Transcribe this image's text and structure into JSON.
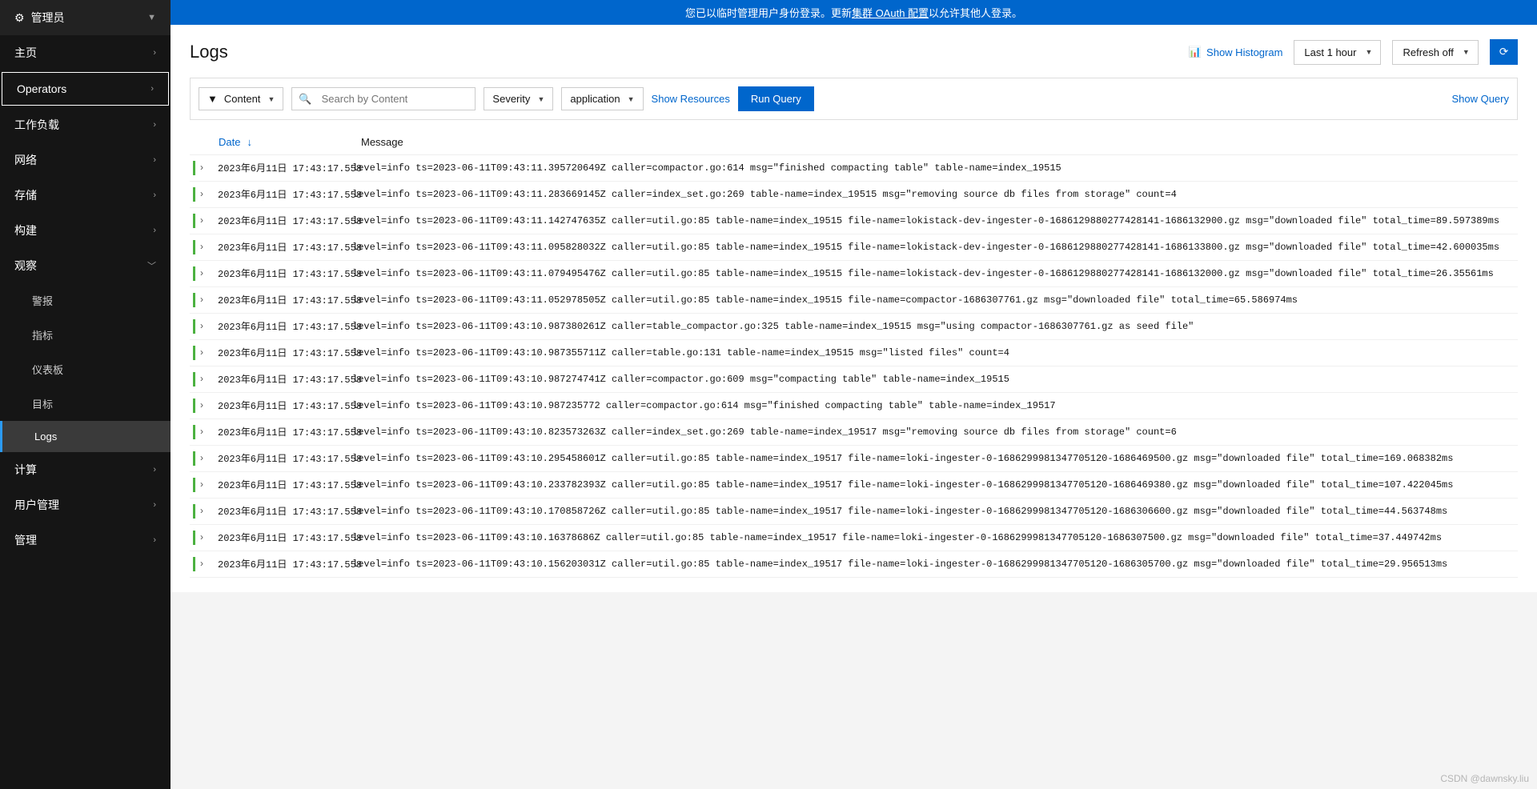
{
  "banner": {
    "prefix": "您已以临时管理用户身份登录。更新",
    "link": "集群 OAuth 配置",
    "suffix": "以允许其他人登录。"
  },
  "sidebar": {
    "admin": "管理员",
    "items": [
      {
        "label": "主页"
      },
      {
        "label": "Operators",
        "selected": true
      },
      {
        "label": "工作负载"
      },
      {
        "label": "网络"
      },
      {
        "label": "存储"
      },
      {
        "label": "构建"
      },
      {
        "label": "观察",
        "expanded": true,
        "children": [
          {
            "label": "警报"
          },
          {
            "label": "指标"
          },
          {
            "label": "仪表板"
          },
          {
            "label": "目标"
          },
          {
            "label": "Logs",
            "active": true
          }
        ]
      },
      {
        "label": "计算"
      },
      {
        "label": "用户管理"
      },
      {
        "label": "管理"
      }
    ]
  },
  "page": {
    "title": "Logs",
    "show_histogram": "Show Histogram",
    "time_range": "Last 1 hour",
    "refresh": "Refresh off"
  },
  "query_bar": {
    "content": "Content",
    "search_placeholder": "Search by Content",
    "severity": "Severity",
    "log_type": "application",
    "show_resources": "Show Resources",
    "run_query": "Run Query",
    "show_query": "Show Query"
  },
  "table": {
    "date_header": "Date",
    "message_header": "Message"
  },
  "logs": [
    {
      "date": "2023年6月11日 17:43:17.558",
      "msg": "level=info ts=2023-06-11T09:43:11.395720649Z caller=compactor.go:614 msg=\"finished compacting table\" table-name=index_19515"
    },
    {
      "date": "2023年6月11日 17:43:17.558",
      "msg": "level=info ts=2023-06-11T09:43:11.283669145Z caller=index_set.go:269 table-name=index_19515 msg=\"removing source db files from storage\" count=4"
    },
    {
      "date": "2023年6月11日 17:43:17.558",
      "msg": "level=info ts=2023-06-11T09:43:11.142747635Z caller=util.go:85 table-name=index_19515 file-name=lokistack-dev-ingester-0-1686129880277428141-1686132900.gz msg=\"downloaded file\" total_time=89.597389ms"
    },
    {
      "date": "2023年6月11日 17:43:17.558",
      "msg": "level=info ts=2023-06-11T09:43:11.095828032Z caller=util.go:85 table-name=index_19515 file-name=lokistack-dev-ingester-0-1686129880277428141-1686133800.gz msg=\"downloaded file\" total_time=42.600035ms"
    },
    {
      "date": "2023年6月11日 17:43:17.558",
      "msg": "level=info ts=2023-06-11T09:43:11.079495476Z caller=util.go:85 table-name=index_19515 file-name=lokistack-dev-ingester-0-1686129880277428141-1686132000.gz msg=\"downloaded file\" total_time=26.35561ms"
    },
    {
      "date": "2023年6月11日 17:43:17.558",
      "msg": "level=info ts=2023-06-11T09:43:11.052978505Z caller=util.go:85 table-name=index_19515 file-name=compactor-1686307761.gz msg=\"downloaded file\" total_time=65.586974ms"
    },
    {
      "date": "2023年6月11日 17:43:17.558",
      "msg": "level=info ts=2023-06-11T09:43:10.987380261Z caller=table_compactor.go:325 table-name=index_19515 msg=\"using compactor-1686307761.gz as seed file\""
    },
    {
      "date": "2023年6月11日 17:43:17.558",
      "msg": "level=info ts=2023-06-11T09:43:10.987355711Z caller=table.go:131 table-name=index_19515 msg=\"listed files\" count=4"
    },
    {
      "date": "2023年6月11日 17:43:17.558",
      "msg": "level=info ts=2023-06-11T09:43:10.987274741Z caller=compactor.go:609 msg=\"compacting table\" table-name=index_19515"
    },
    {
      "date": "2023年6月11日 17:43:17.558",
      "msg": "level=info ts=2023-06-11T09:43:10.987235772 caller=compactor.go:614 msg=\"finished compacting table\" table-name=index_19517"
    },
    {
      "date": "2023年6月11日 17:43:17.558",
      "msg": "level=info ts=2023-06-11T09:43:10.823573263Z caller=index_set.go:269 table-name=index_19517 msg=\"removing source db files from storage\" count=6"
    },
    {
      "date": "2023年6月11日 17:43:17.558",
      "msg": "level=info ts=2023-06-11T09:43:10.295458601Z caller=util.go:85 table-name=index_19517 file-name=loki-ingester-0-1686299981347705120-1686469500.gz msg=\"downloaded file\" total_time=169.068382ms"
    },
    {
      "date": "2023年6月11日 17:43:17.558",
      "msg": "level=info ts=2023-06-11T09:43:10.233782393Z caller=util.go:85 table-name=index_19517 file-name=loki-ingester-0-1686299981347705120-1686469380.gz msg=\"downloaded file\" total_time=107.422045ms"
    },
    {
      "date": "2023年6月11日 17:43:17.558",
      "msg": "level=info ts=2023-06-11T09:43:10.170858726Z caller=util.go:85 table-name=index_19517 file-name=loki-ingester-0-1686299981347705120-1686306600.gz msg=\"downloaded file\" total_time=44.563748ms"
    },
    {
      "date": "2023年6月11日 17:43:17.558",
      "msg": "level=info ts=2023-06-11T09:43:10.16378686Z caller=util.go:85 table-name=index_19517 file-name=loki-ingester-0-1686299981347705120-1686307500.gz msg=\"downloaded file\" total_time=37.449742ms"
    },
    {
      "date": "2023年6月11日 17:43:17.558",
      "msg": "level=info ts=2023-06-11T09:43:10.156203031Z caller=util.go:85 table-name=index_19517 file-name=loki-ingester-0-1686299981347705120-1686305700.gz msg=\"downloaded file\" total_time=29.956513ms"
    }
  ],
  "watermark": "CSDN @dawnsky.liu"
}
